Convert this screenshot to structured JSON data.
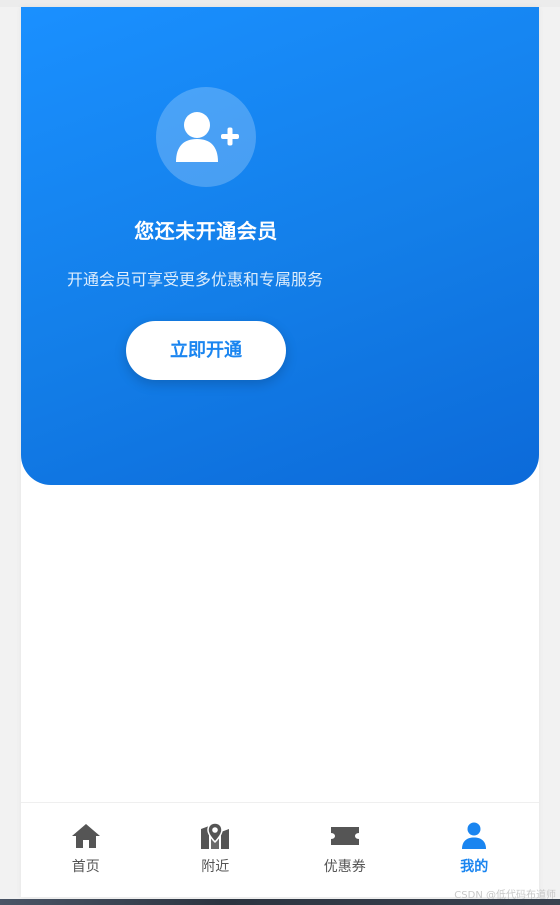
{
  "hero": {
    "title": "您还未开通会员",
    "subtitle": "开通会员可享受更多优惠和专属服务",
    "cta_label": "立即开通",
    "avatar_icon": "user-plus-icon"
  },
  "tabbar": {
    "items": [
      {
        "label": "首页",
        "icon": "home-icon",
        "active": false
      },
      {
        "label": "附近",
        "icon": "map-marker-icon",
        "active": false
      },
      {
        "label": "优惠券",
        "icon": "ticket-icon",
        "active": false
      },
      {
        "label": "我的",
        "icon": "user-icon",
        "active": true
      }
    ]
  },
  "watermark": "CSDN @低代码布道师",
  "colors": {
    "brand": "#1a85f0",
    "inactive_tab": "#555555",
    "background": "#ffffff"
  }
}
